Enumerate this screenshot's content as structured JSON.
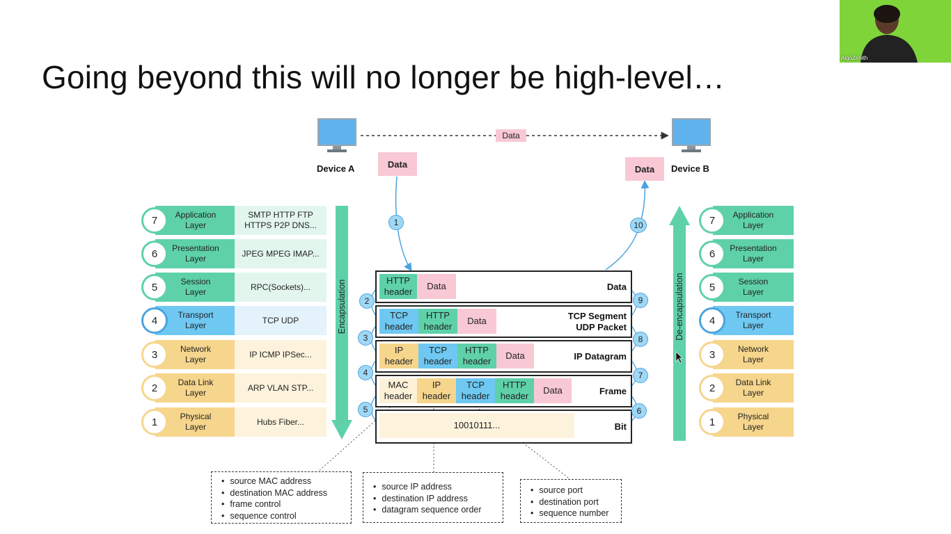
{
  "slide": {
    "title": "Going beyond this will no longer be high-level…"
  },
  "webcam": {
    "name": "AlgoZenith"
  },
  "devices": {
    "a_label": "Device A",
    "b_label": "Device B",
    "link_label": "Data",
    "a_data": "Data",
    "b_data": "Data"
  },
  "stacks": {
    "layers": [
      {
        "num": "7",
        "name_line1": "Application",
        "name_line2": "Layer",
        "proto_line1": "SMTP HTTP FTP",
        "proto_line2": "HTTPS P2P DNS..."
      },
      {
        "num": "6",
        "name_line1": "Presentation",
        "name_line2": "Layer",
        "proto_line1": "JPEG MPEG IMAP...",
        "proto_line2": ""
      },
      {
        "num": "5",
        "name_line1": "Session",
        "name_line2": "Layer",
        "proto_line1": "RPC(Sockets)...",
        "proto_line2": ""
      },
      {
        "num": "4",
        "name_line1": "Transport",
        "name_line2": "Layer",
        "proto_line1": "TCP UDP",
        "proto_line2": ""
      },
      {
        "num": "3",
        "name_line1": "Network",
        "name_line2": "Layer",
        "proto_line1": "IP ICMP IPSec...",
        "proto_line2": ""
      },
      {
        "num": "2",
        "name_line1": "Data Link",
        "name_line2": "Layer",
        "proto_line1": "ARP VLAN STP...",
        "proto_line2": ""
      },
      {
        "num": "1",
        "name_line1": "Physical",
        "name_line2": "Layer",
        "proto_line1": "Hubs Fiber...",
        "proto_line2": ""
      }
    ],
    "encapsulation_label": "Encapsulation",
    "deencapsulation_label": "De-encapsulation"
  },
  "pdus": {
    "data_row": {
      "http_hdr_1": "HTTP",
      "http_hdr_2": "header",
      "data": "Data",
      "label": "Data"
    },
    "segment_row": {
      "tcp_hdr_1": "TCP",
      "tcp_hdr_2": "header",
      "http_hdr_1": "HTTP",
      "http_hdr_2": "header",
      "data": "Data",
      "label_1": "TCP Segment",
      "label_2": "UDP Packet"
    },
    "datagram_row": {
      "ip_hdr_1": "IP",
      "ip_hdr_2": "header",
      "tcp_hdr_1": "TCP",
      "tcp_hdr_2": "header",
      "http_hdr_1": "HTTP",
      "http_hdr_2": "header",
      "data": "Data",
      "label": "IP Datagram"
    },
    "frame_row": {
      "mac_hdr_1": "MAC",
      "mac_hdr_2": "header",
      "ip_hdr_1": "IP",
      "ip_hdr_2": "header",
      "tcp_hdr_1": "TCP",
      "tcp_hdr_2": "header",
      "http_hdr_1": "HTTP",
      "http_hdr_2": "header",
      "data": "Data",
      "label": "Frame"
    },
    "bit_row": {
      "bits": "10010111...",
      "label": "Bit"
    }
  },
  "steps": [
    "1",
    "2",
    "3",
    "4",
    "5",
    "6",
    "7",
    "8",
    "9",
    "10"
  ],
  "notes": {
    "mac": [
      "source MAC address",
      "destination MAC address",
      "frame control",
      "sequence control"
    ],
    "ip": [
      "source IP address",
      "destination IP address",
      "datagram sequence order"
    ],
    "tcp": [
      "source port",
      "destination port",
      "sequence number"
    ]
  },
  "colors": {
    "green": "#5fd1a9",
    "blue": "#6ec8f2",
    "yellow": "#f6d58c",
    "pink": "#f8c8d4",
    "webcam_bg": "#7fd43a"
  }
}
